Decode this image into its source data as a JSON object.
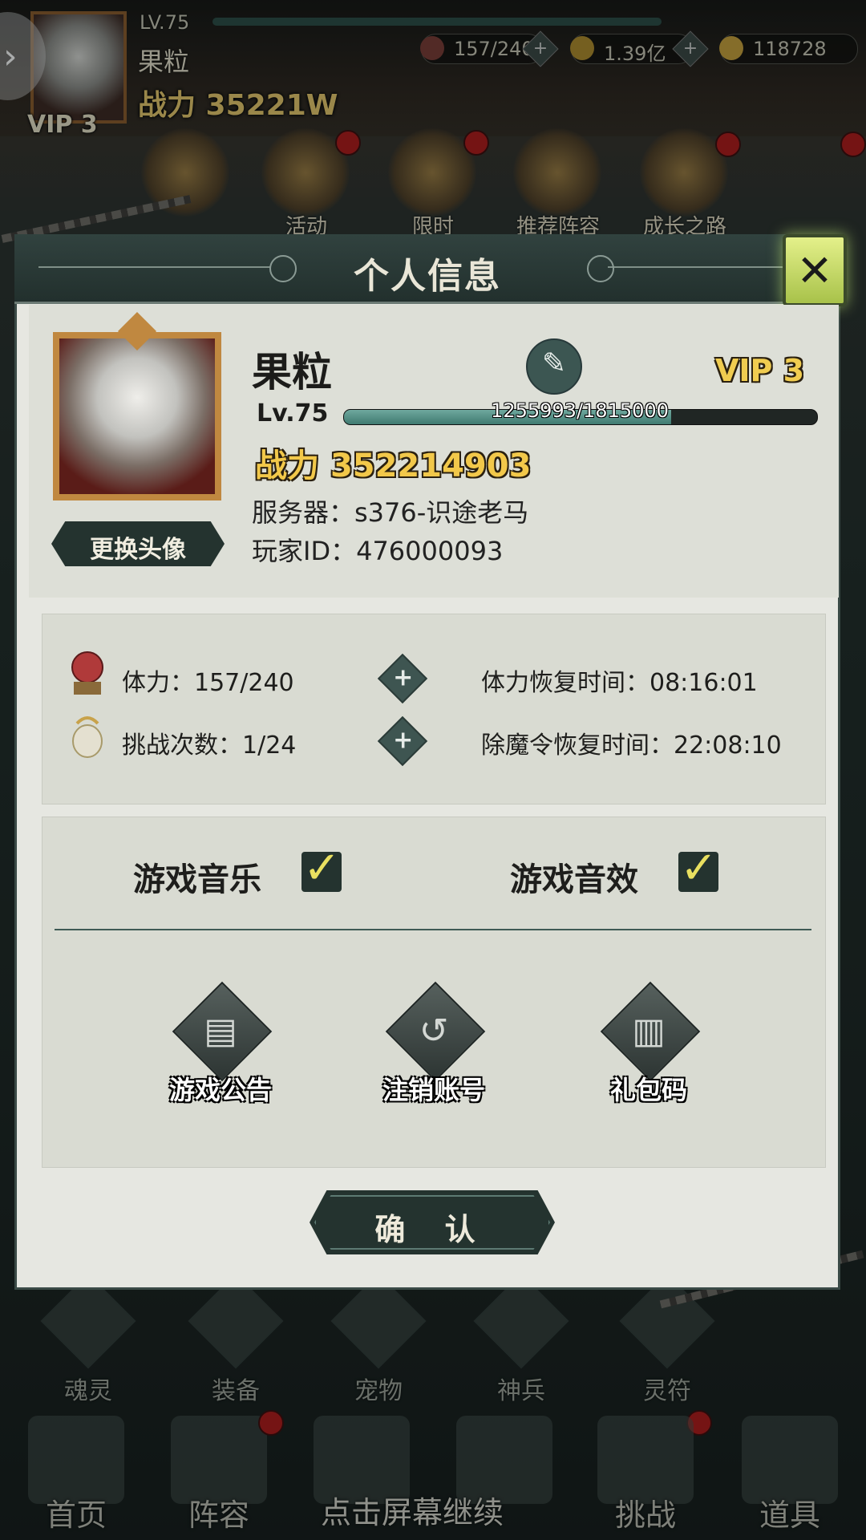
{
  "background": {
    "level": "LV.75",
    "name": "果粒",
    "power": "战力 35221W",
    "vip": "VIP 3",
    "resources": [
      {
        "icon": "stamina-icon",
        "value": "157/240"
      },
      {
        "icon": "coin-icon",
        "value": "1.39亿"
      },
      {
        "icon": "gold-ingot-icon",
        "value": "118728"
      }
    ],
    "top_icons": [
      "活动",
      "限时",
      "推荐阵容",
      "成长之路"
    ],
    "sub_nav": [
      "魂灵",
      "装备",
      "宠物",
      "神兵",
      "灵符"
    ],
    "main_nav": [
      "首页",
      "阵容",
      "挑战",
      "道具"
    ],
    "hint": "点击屏幕继续"
  },
  "dialog": {
    "title": "个人信息",
    "change_avatar": "更换头像",
    "player_name": "果粒",
    "vip": "VIP 3",
    "level": "Lv.75",
    "exp_text": "1255993/1815000",
    "exp_fraction": 0.692,
    "power_label": "战力",
    "power_value": "352214903",
    "server": "服务器：s376-识途老马",
    "player_id": "玩家ID：476000093",
    "stats": {
      "stamina": "体力：157/240",
      "stamina_recover": "体力恢复时间：08:16:01",
      "challenges": "挑战次数：1/24",
      "token_recover": "除魔令恢复时间：22:08:10"
    },
    "settings": {
      "music": "游戏音乐",
      "sound": "游戏音效",
      "music_on": true,
      "sound_on": true
    },
    "actions": [
      "游戏公告",
      "注销账号",
      "礼包码"
    ],
    "confirm": "确 认"
  },
  "colors": {
    "accent_gold": "#f2c84a",
    "panel_dark": "#24332f",
    "exp_fill": "#4f8c82",
    "close_button": "#cfe06a"
  }
}
